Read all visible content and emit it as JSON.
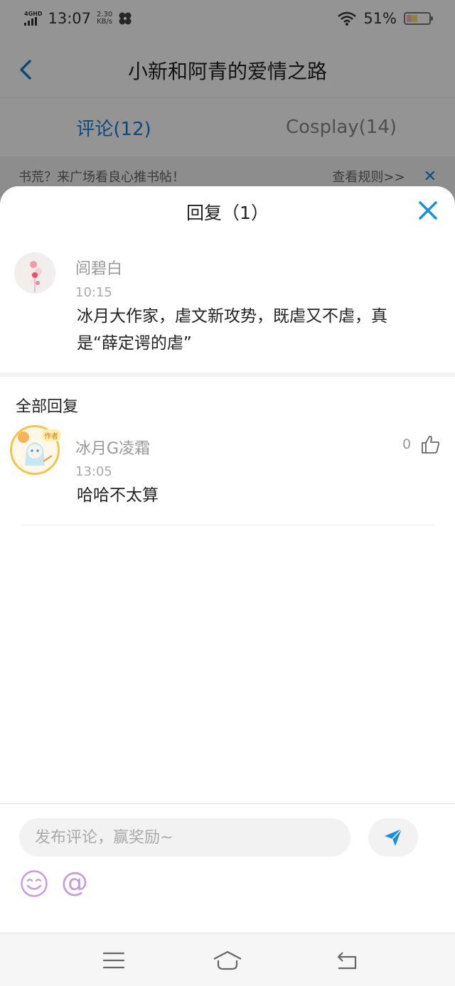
{
  "status": {
    "network_tag": "4GHD",
    "time": "13:07",
    "speed_value": "2.30",
    "speed_unit": "KB/s",
    "battery": "51%",
    "battery_level": 0.51
  },
  "header": {
    "title": "小新和阿青的爱情之路"
  },
  "tabs": [
    {
      "label": "评论(12)",
      "active": true
    },
    {
      "label": "Cosplay(14)",
      "active": false
    }
  ],
  "notice": {
    "text": "书荒？来广场看良心推书帖！",
    "link": "查看规则>>",
    "close": "✕"
  },
  "sheet": {
    "title": "回复（1）",
    "original": {
      "author": "闾碧白",
      "time": "10:15",
      "content_line1": "冰月大作家，虐文新攻势，既虐又不虐，真",
      "content_line2": "是“薛定谔的虐”"
    },
    "section_title": "全部回复",
    "replies": [
      {
        "author": "冰月G凌霜",
        "time": "13:05",
        "content": "哈哈不太算",
        "likes": "0",
        "badge": "作者"
      }
    ]
  },
  "composer": {
    "placeholder": "发布评论，赢奖励~",
    "at_symbol": "@"
  },
  "colors": {
    "accent": "#1a7fd6",
    "purple": "#c79ae0"
  }
}
